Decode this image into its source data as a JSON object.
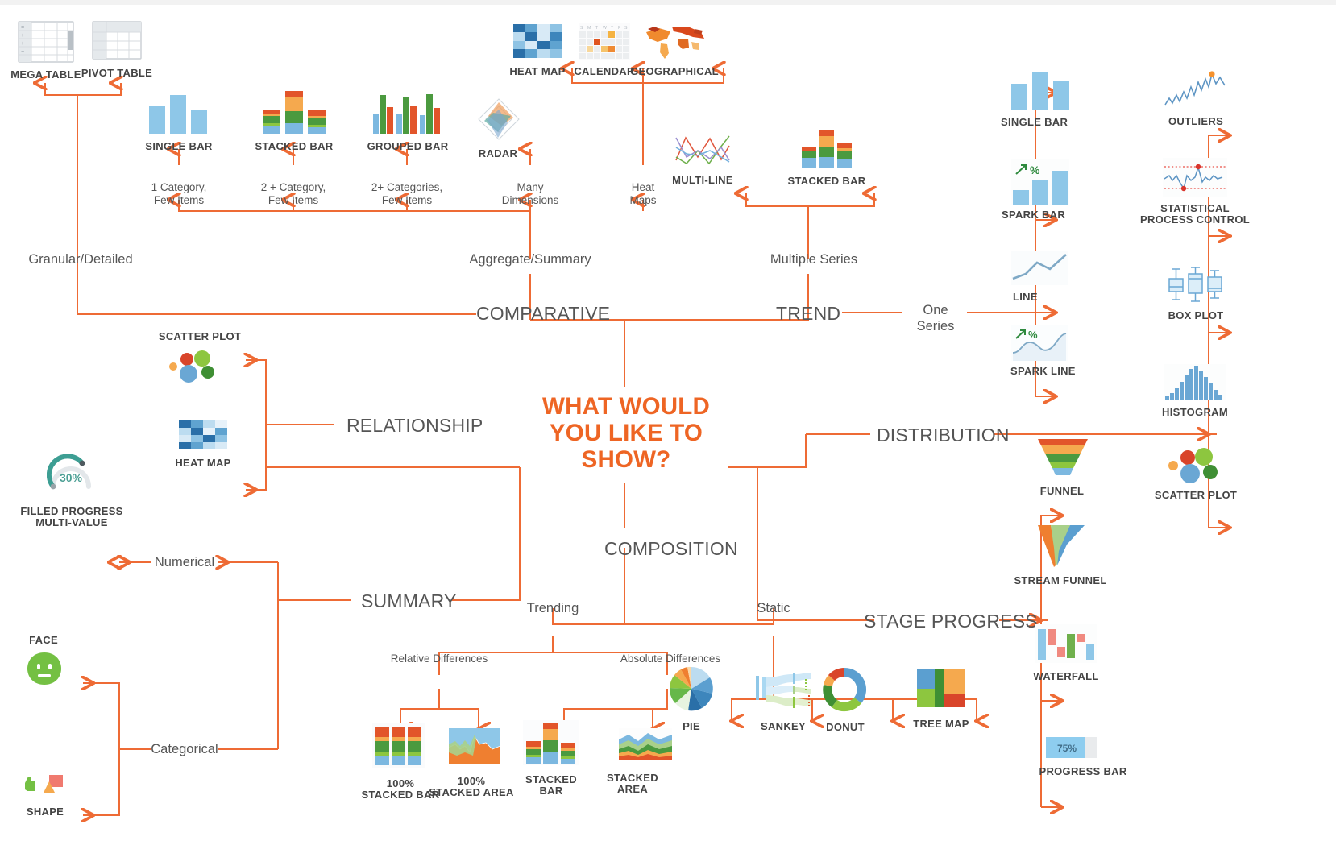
{
  "diagram": {
    "center_title": "WHAT WOULD YOU LIKE TO SHOW?",
    "center_title_lines": [
      "WHAT WOULD",
      "YOU LIKE TO",
      "SHOW?"
    ],
    "accent_color": "#ee6524",
    "line_color": "#ee6b35",
    "text_color": "#555555",
    "cap_color": "#444444"
  },
  "branches": {
    "comparative": "COMPARATIVE",
    "trend": "TREND",
    "relationship": "RELATIONSHIP",
    "distribution": "DISTRIBUTION",
    "summary": "SUMMARY",
    "composition": "COMPOSITION",
    "stage_progress": "STAGE PROGRESS"
  },
  "edge_labels": {
    "granular_detailed": "Granular/Detailed",
    "aggregate_summary": "Aggregate/Summary",
    "multiple_series": "Multiple Series",
    "one_series": "One Series",
    "one_category_few_items": [
      "1 Category,",
      "Few Items"
    ],
    "two_plus_category_few_items": [
      "2 + Category,",
      "Few Items"
    ],
    "two_plus_categories_few_items": [
      "2+ Categories,",
      "Few Items"
    ],
    "many_dimensions": [
      "Many",
      "Dimensions"
    ],
    "heat_maps": [
      "Heat",
      "Maps"
    ],
    "numerical": "Numerical",
    "categorical": "Categorical",
    "trending": "Trending",
    "static": "Static",
    "relative_differences": "Relative Differences",
    "absolute_differences": "Absolute Differences"
  },
  "chart_types": {
    "mega_table": "MEGA TABLE",
    "pivot_table": "PIVOT TABLE",
    "single_bar_comp": "SINGLE BAR",
    "stacked_bar_comp": "STACKED BAR",
    "grouped_bar": "GROUPED BAR",
    "radar": "RADAR",
    "heat_map_top": "HEAT MAP",
    "calendar": "CALENDAR",
    "geographical": "GEOGRAPHICAL",
    "multi_line": "MULTI-LINE",
    "stacked_bar_trend": "STACKED BAR",
    "single_bar_trend": "SINGLE BAR",
    "spark_bar": "SPARK BAR",
    "line": "LINE",
    "spark_line": "SPARK LINE",
    "outliers": "OUTLIERS",
    "statistical_process_control": [
      "STATISTICAL",
      "PROCESS CONTROL"
    ],
    "box_plot": "BOX PLOT",
    "histogram": "HISTOGRAM",
    "scatter_plot_dist": "SCATTER PLOT",
    "scatter_plot_rel": "SCATTER PLOT",
    "heat_map_rel": "HEAT MAP",
    "filled_progress_multi_value": [
      "FILLED PROGRESS",
      "MULTI-VALUE"
    ],
    "face": "FACE",
    "shape": "SHAPE",
    "pct100_stacked_bar": [
      "100%",
      "STACKED BAR"
    ],
    "pct100_stacked_area": [
      "100%",
      "STACKED AREA"
    ],
    "stacked_bar_comp_abs": [
      "STACKED",
      "BAR"
    ],
    "stacked_area": [
      "STACKED",
      "AREA"
    ],
    "pie": "PIE",
    "sankey": "SANKEY",
    "donut": "DONUT",
    "tree_map": "TREE MAP",
    "funnel": "FUNNEL",
    "stream_funnel": "STREAM FUNNEL",
    "waterfall": "WATERFALL",
    "progress_bar": "PROGRESS BAR"
  },
  "icon_values": {
    "filled_progress_value": "30%",
    "progress_bar_value": "75%",
    "spark_bar_badge": "%",
    "spark_line_badge": "%",
    "calendar_weekdays": [
      "S",
      "M",
      "T",
      "W",
      "T",
      "F",
      "S"
    ]
  },
  "chart_data": {
    "type": "diagram",
    "title": "WHAT WOULD YOU LIKE TO SHOW?",
    "description": "Chart-selection decision tree radiating from a central question into seven intent branches, each terminating in recommended visualization types.",
    "nodes": [
      {
        "id": "root",
        "label": "WHAT WOULD YOU LIKE TO SHOW?",
        "level": 0
      },
      {
        "id": "comparative",
        "label": "COMPARATIVE",
        "level": 1
      },
      {
        "id": "trend",
        "label": "TREND",
        "level": 1
      },
      {
        "id": "relationship",
        "label": "RELATIONSHIP",
        "level": 1
      },
      {
        "id": "distribution",
        "label": "DISTRIBUTION",
        "level": 1
      },
      {
        "id": "summary",
        "label": "SUMMARY",
        "level": 1
      },
      {
        "id": "composition",
        "label": "COMPOSITION",
        "level": 1
      },
      {
        "id": "stage_progress",
        "label": "STAGE PROGRESS",
        "level": 1
      }
    ],
    "edges": [
      {
        "from": "root",
        "to": "comparative",
        "label": ""
      },
      {
        "from": "comparative",
        "to": "mega-table",
        "label": "Granular/Detailed"
      },
      {
        "from": "comparative",
        "to": "pivot-table",
        "label": "Granular/Detailed"
      },
      {
        "from": "comparative",
        "to": "single-bar",
        "label": "Aggregate/Summary > 1 Category, Few Items"
      },
      {
        "from": "comparative",
        "to": "stacked-bar",
        "label": "Aggregate/Summary > 2 + Category, Few Items"
      },
      {
        "from": "comparative",
        "to": "grouped-bar",
        "label": "Aggregate/Summary > 2+ Categories, Few Items"
      },
      {
        "from": "comparative",
        "to": "radar",
        "label": "Aggregate/Summary > Many Dimensions"
      },
      {
        "from": "comparative",
        "to": "heat-map",
        "label": "Aggregate/Summary > Heat Maps"
      },
      {
        "from": "comparative",
        "to": "calendar",
        "label": "Aggregate/Summary > Heat Maps"
      },
      {
        "from": "comparative",
        "to": "geographical",
        "label": "Aggregate/Summary > Heat Maps"
      },
      {
        "from": "root",
        "to": "trend",
        "label": ""
      },
      {
        "from": "trend",
        "to": "multi-line",
        "label": "Multiple Series"
      },
      {
        "from": "trend",
        "to": "stacked-bar-trend",
        "label": "Multiple Series"
      },
      {
        "from": "trend",
        "to": "single-bar-trend",
        "label": "One Series"
      },
      {
        "from": "trend",
        "to": "spark-bar",
        "label": "One Series"
      },
      {
        "from": "trend",
        "to": "line",
        "label": "One Series"
      },
      {
        "from": "trend",
        "to": "spark-line",
        "label": "One Series"
      },
      {
        "from": "root",
        "to": "relationship",
        "label": ""
      },
      {
        "from": "relationship",
        "to": "scatter-plot",
        "label": ""
      },
      {
        "from": "relationship",
        "to": "heat-map-rel",
        "label": ""
      },
      {
        "from": "root",
        "to": "distribution",
        "label": ""
      },
      {
        "from": "distribution",
        "to": "outliers",
        "label": ""
      },
      {
        "from": "distribution",
        "to": "statistical-process-control",
        "label": ""
      },
      {
        "from": "distribution",
        "to": "box-plot",
        "label": ""
      },
      {
        "from": "distribution",
        "to": "histogram",
        "label": ""
      },
      {
        "from": "distribution",
        "to": "scatter-plot-dist",
        "label": ""
      },
      {
        "from": "root",
        "to": "summary",
        "label": ""
      },
      {
        "from": "summary",
        "to": "filled-progress-multi-value",
        "label": "Numerical"
      },
      {
        "from": "summary",
        "to": "face",
        "label": "Categorical"
      },
      {
        "from": "summary",
        "to": "shape",
        "label": "Categorical"
      },
      {
        "from": "root",
        "to": "composition",
        "label": ""
      },
      {
        "from": "composition",
        "to": "100-stacked-bar",
        "label": "Trending > Relative Differences"
      },
      {
        "from": "composition",
        "to": "100-stacked-area",
        "label": "Trending > Relative Differences"
      },
      {
        "from": "composition",
        "to": "stacked-bar-abs",
        "label": "Trending > Absolute Differences"
      },
      {
        "from": "composition",
        "to": "stacked-area",
        "label": "Trending > Absolute Differences"
      },
      {
        "from": "composition",
        "to": "pie",
        "label": "Static"
      },
      {
        "from": "composition",
        "to": "sankey",
        "label": "Static"
      },
      {
        "from": "composition",
        "to": "donut",
        "label": "Static"
      },
      {
        "from": "composition",
        "to": "tree-map",
        "label": "Static"
      },
      {
        "from": "root",
        "to": "stage_progress",
        "label": ""
      },
      {
        "from": "stage_progress",
        "to": "funnel",
        "label": ""
      },
      {
        "from": "stage_progress",
        "to": "stream-funnel",
        "label": ""
      },
      {
        "from": "stage_progress",
        "to": "waterfall",
        "label": ""
      },
      {
        "from": "stage_progress",
        "to": "progress-bar",
        "label": ""
      }
    ]
  }
}
